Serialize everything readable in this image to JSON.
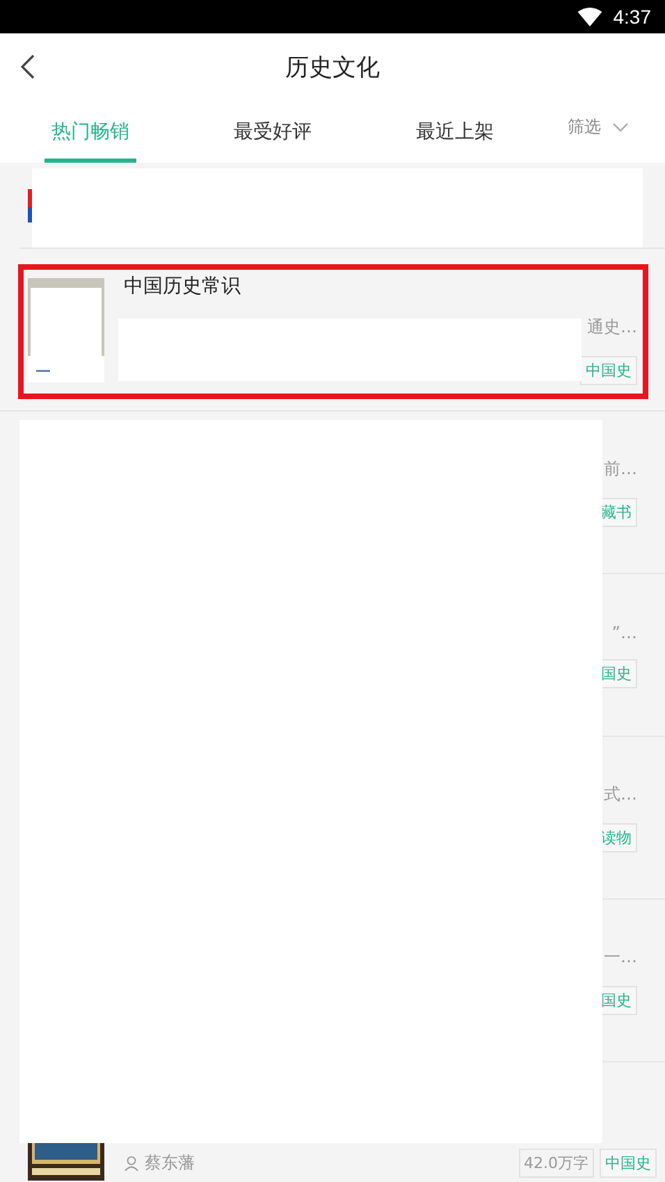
{
  "status_bar": {
    "time": "4:37"
  },
  "header": {
    "title": "历史文化"
  },
  "tabs": [
    {
      "label": "热门畅销",
      "selected": true
    },
    {
      "label": "最受好评",
      "selected": false
    },
    {
      "label": "最近上架",
      "selected": false
    }
  ],
  "filter": {
    "label": "筛选"
  },
  "books": [
    {
      "kind": "partial"
    },
    {
      "kind": "full",
      "highlighted": true,
      "title": "中国历史常识",
      "description": "通史…",
      "tag": "中国史"
    },
    {
      "kind": "masked",
      "description": "前…",
      "tag": "藏书"
    },
    {
      "kind": "masked",
      "description": "”…",
      "tag": "国史"
    },
    {
      "kind": "masked",
      "description": "式…",
      "tag": "读物"
    },
    {
      "kind": "masked",
      "description": "一…",
      "tag": "国史"
    },
    {
      "kind": "bottom",
      "author": "蔡东藩",
      "word_count": "42.0万字",
      "tag": "中国史"
    }
  ]
}
